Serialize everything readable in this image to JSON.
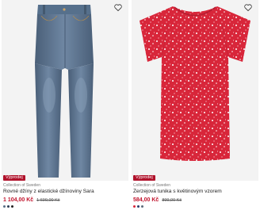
{
  "products": [
    {
      "badge": "Výprodej",
      "brand": "Collection of Sweden",
      "title": "Rovné džíny z elastické džínoviny Sara",
      "price": "1 104,00 Kč",
      "old_price": "1 699,00 Kč",
      "image_icon": "jeans-icon",
      "swatch_colors": [
        "#5a6f86",
        "#2d3d55",
        "#222222"
      ]
    },
    {
      "badge": "Výprodej",
      "brand": "Collection of Sweden",
      "title": "Žerzejová tunika s květinovým vzorem",
      "price": "584,00 Kč",
      "old_price": "899,00 Kč",
      "image_icon": "tunic-icon",
      "swatch_colors": [
        "#d8263a",
        "#2b3c6b",
        "#5b6b7a"
      ]
    }
  ],
  "colors": {
    "accent": "#c0122b",
    "badge_bg": "#b0122b",
    "denim": "#5e7590",
    "tunic_red": "#d8263a"
  }
}
